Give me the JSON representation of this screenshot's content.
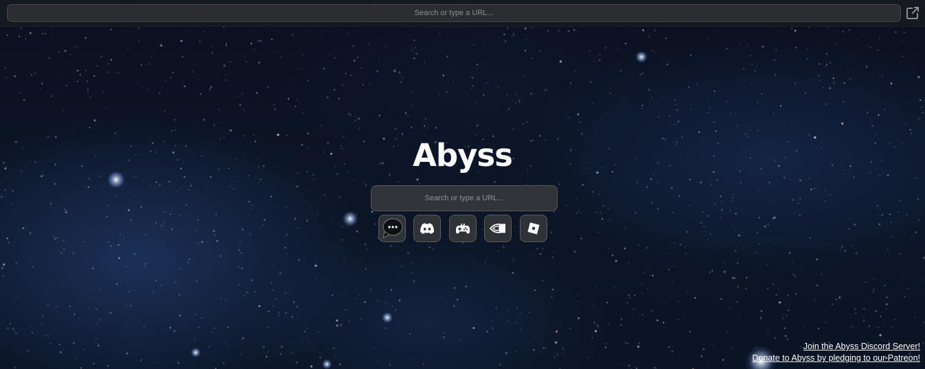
{
  "topbar": {
    "url_placeholder": "Search or type a URL...",
    "open_icon": "open-in-new-window-icon"
  },
  "brand": {
    "title": "Abyss"
  },
  "search": {
    "placeholder": "Search or type a URL..."
  },
  "shortcuts": [
    {
      "icon": "chat-bubble-icon"
    },
    {
      "icon": "discord-icon"
    },
    {
      "icon": "gamepad-icon"
    },
    {
      "icon": "nvidia-icon"
    },
    {
      "icon": "roblox-icon"
    }
  ],
  "footer": {
    "discord_link": "Join the Abyss Discord Server!",
    "patreon_link": "Donate to Abyss by pledging to our Patreon!"
  },
  "colors": {
    "background": "#0b1424",
    "accent_text": "#ffffff",
    "input_background": "#2b2d31"
  }
}
